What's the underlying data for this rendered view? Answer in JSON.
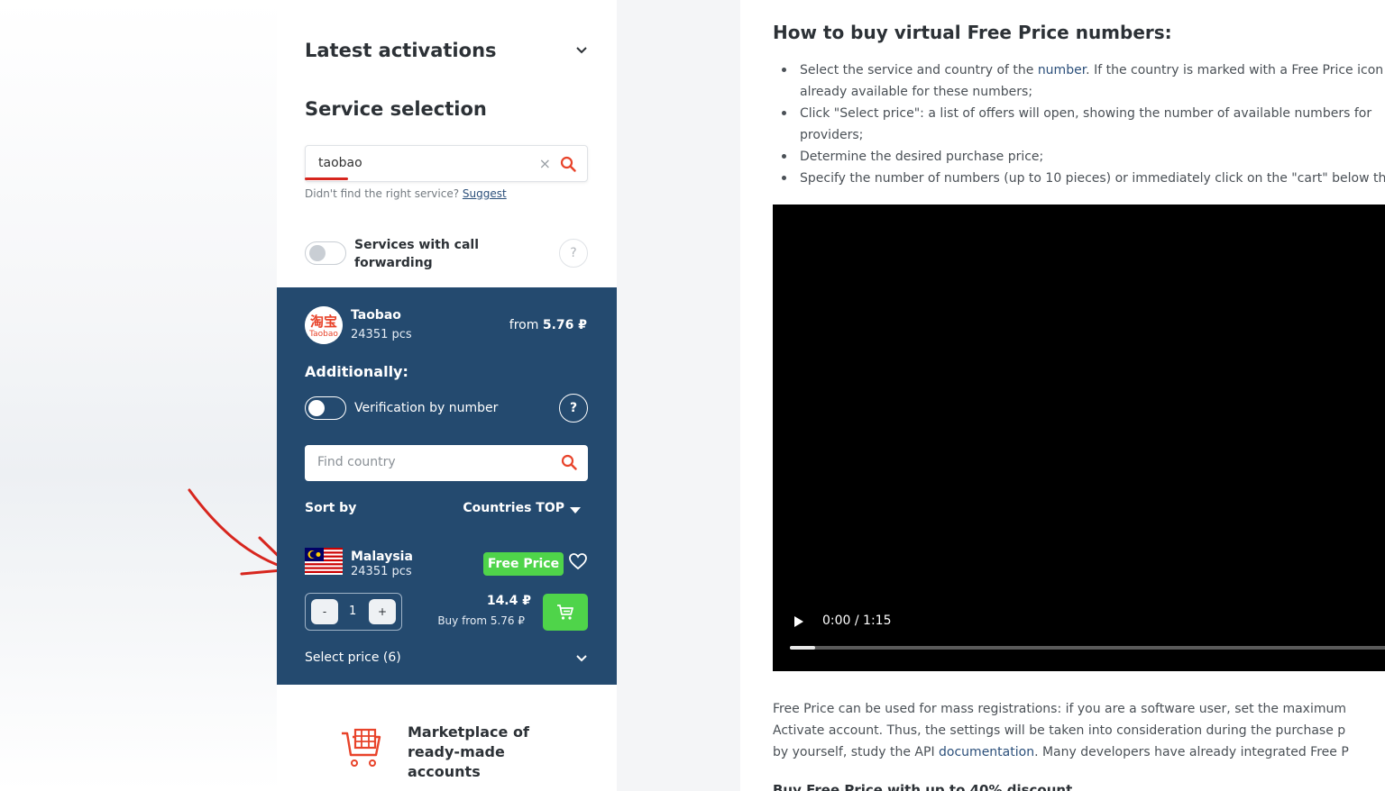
{
  "sidebar": {
    "latest_activations": "Latest activations",
    "service_selection": "Service selection",
    "search": {
      "value": "taobao",
      "clear": "×"
    },
    "hint_text": "Didn't find the right service?",
    "hint_link": "Suggest",
    "call_forwarding_label": "Services with call forwarding",
    "help": "?"
  },
  "service": {
    "logo_text_top": "淘宝",
    "logo_text_bottom": "Taobao",
    "name": "Taobao",
    "pcs": "24351 pcs",
    "price_prefix": "from",
    "price": "5.76 ₽",
    "additionally": "Additionally:",
    "verification_label": "Verification by number",
    "help": "?",
    "country_search_placeholder": "Find country",
    "sort_by": "Sort by",
    "sort_value": "Countries TOP"
  },
  "country": {
    "name": "Malaysia",
    "pcs": "24351 pcs",
    "badge": "Free Price",
    "minus": "-",
    "qty": "1",
    "plus": "+",
    "price": "14.4 ₽",
    "buy_from": "Buy from 5.76 ₽",
    "select_price": "Select price (6)"
  },
  "marketplace": {
    "text": "Marketplace of ready-made accounts"
  },
  "content": {
    "heading": "How to buy virtual Free Price numbers:",
    "bullets": [
      {
        "pre": "Select the service and country of the ",
        "link": "number",
        "post": ". If the country is marked with a Free Price icon"
      },
      {
        "text": "already available for these numbers;"
      },
      {
        "text": "Click \"Select price\": a list of offers will open, showing the number of available numbers for"
      },
      {
        "text": "providers;"
      },
      {
        "text": "Determine the desired purchase price;"
      },
      {
        "text": "Specify the number of numbers (up to 10 pieces) or immediately click on the \"cart\" below th"
      }
    ],
    "video_time": "0:00 / 1:15",
    "video_progress": 0.04,
    "para_line1": "Free Price can be used for mass registrations: if you are a software user, set the maximum",
    "para_line2": "Activate account. Thus, the settings will be taken into consideration during the purchase p",
    "para_line3_pre": "by yourself, study the API ",
    "para_line3_link": "documentation",
    "para_line3_post": ". Many developers have already integrated Free P",
    "cut_heading": "Buy Free Price with up to 40% discount"
  }
}
